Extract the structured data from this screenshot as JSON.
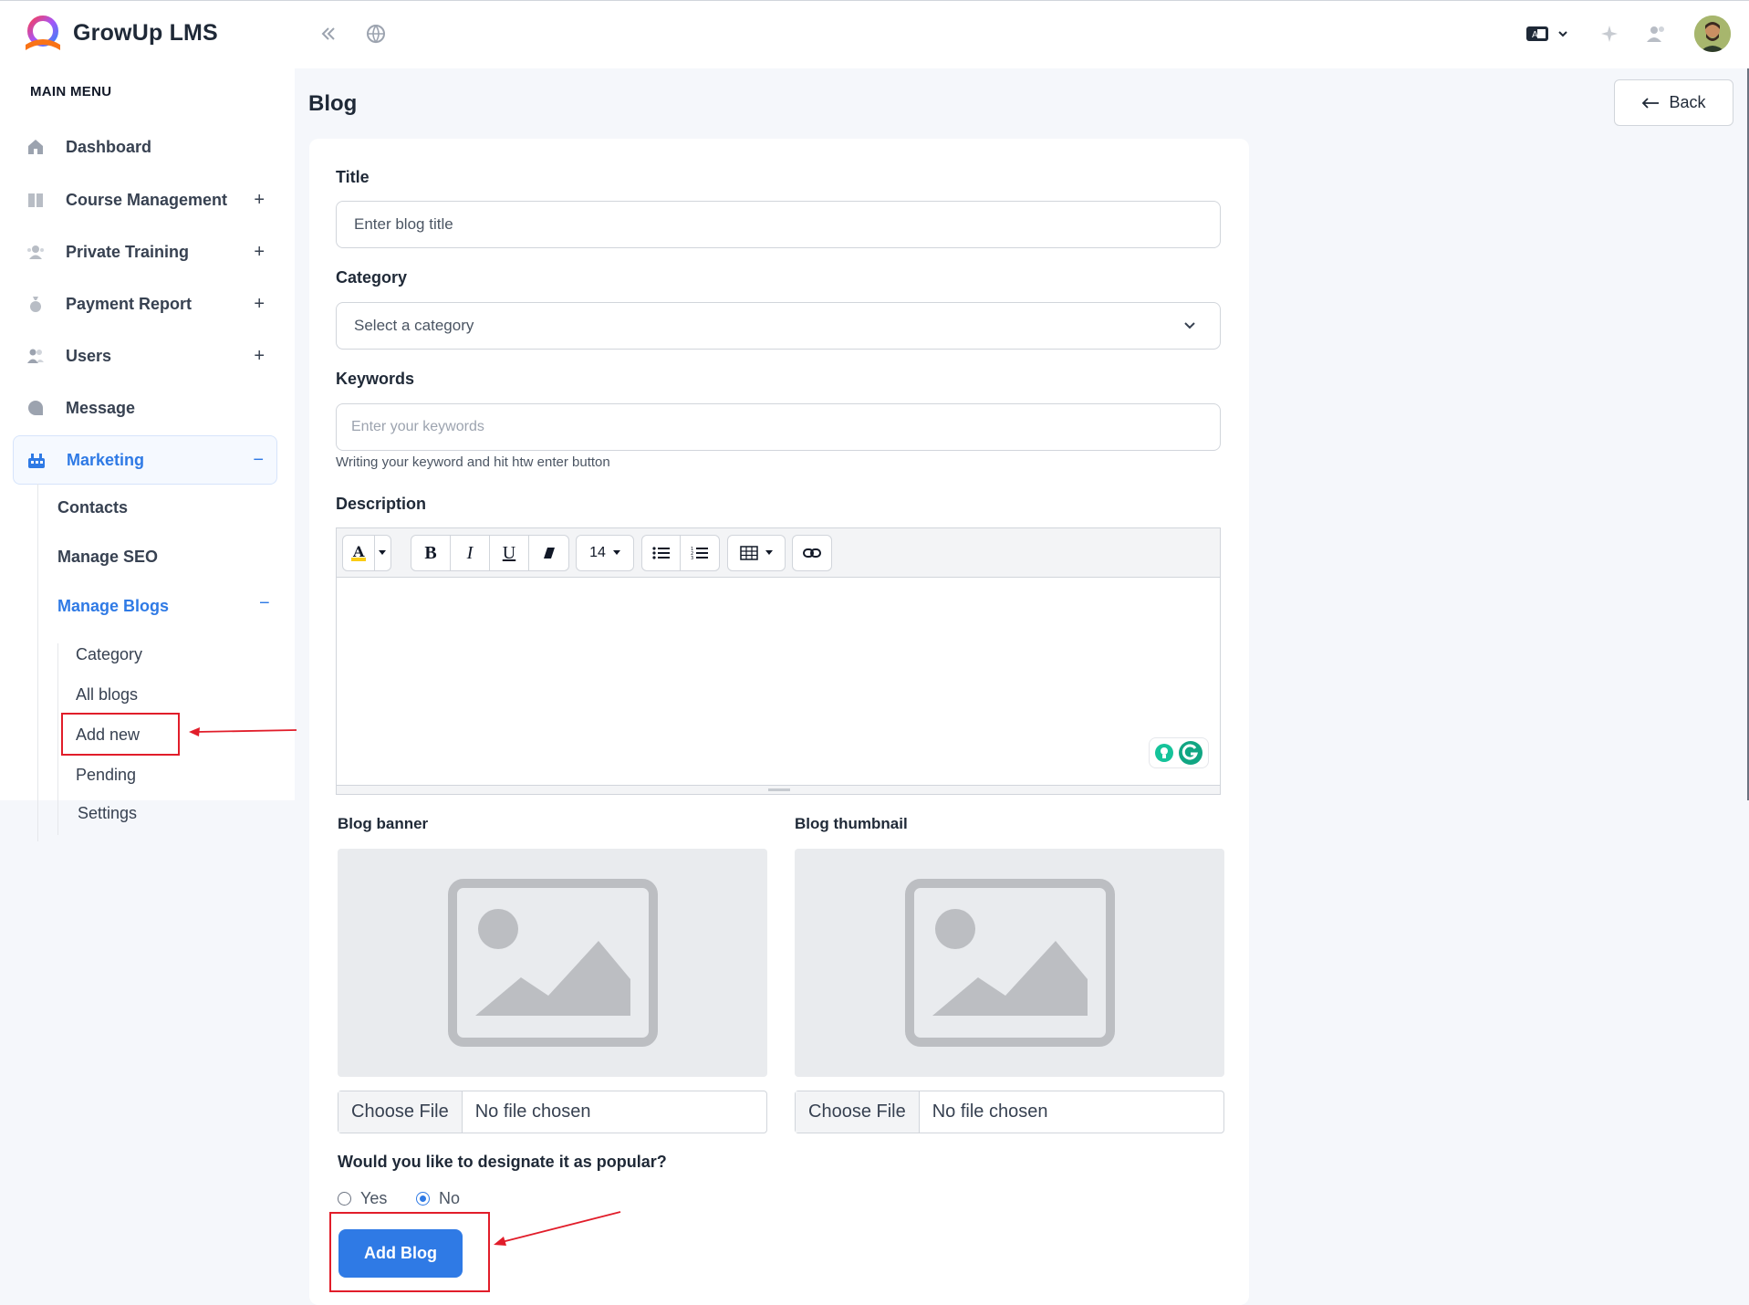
{
  "app": {
    "name": "GrowUp LMS"
  },
  "sidebar": {
    "heading": "MAIN MENU",
    "items": [
      {
        "label": "Dashboard",
        "icon": "home-icon",
        "expand": ""
      },
      {
        "label": "Course Management",
        "icon": "book-icon",
        "expand": "+"
      },
      {
        "label": "Private Training",
        "icon": "trainer-icon",
        "expand": "+"
      },
      {
        "label": "Payment Report",
        "icon": "money-bag-icon",
        "expand": "+"
      },
      {
        "label": "Users",
        "icon": "users-icon",
        "expand": "+"
      },
      {
        "label": "Message",
        "icon": "message-icon",
        "expand": ""
      },
      {
        "label": "Marketing",
        "icon": "marketing-icon",
        "expand": "−"
      }
    ],
    "marketing_sub": [
      "Contacts",
      "Manage SEO",
      "Manage Blogs"
    ],
    "manage_blogs_expand": "−",
    "blogs_sub": [
      "Category",
      "All blogs",
      "Add new",
      "Pending",
      "Settings"
    ]
  },
  "page": {
    "title": "Blog",
    "back_label": "Back"
  },
  "form": {
    "title_label": "Title",
    "title_placeholder": "Enter blog title",
    "category_label": "Category",
    "category_value": "Select a category",
    "keywords_label": "Keywords",
    "keywords_placeholder": "Enter your keywords",
    "keywords_hint": "Writing your keyword and hit htw enter button",
    "description_label": "Description",
    "font_size": "14",
    "banner_label": "Blog banner",
    "thumbnail_label": "Blog thumbnail",
    "choose_file": "Choose File",
    "no_file": "No file chosen",
    "popular_question": "Would you like to designate it as popular?",
    "popular_yes": "Yes",
    "popular_no": "No",
    "popular_selected": "No",
    "submit_label": "Add Blog"
  },
  "colors": {
    "accent": "#2f7ae5",
    "annotation": "#e11d2a",
    "background": "#f5f7fb"
  }
}
